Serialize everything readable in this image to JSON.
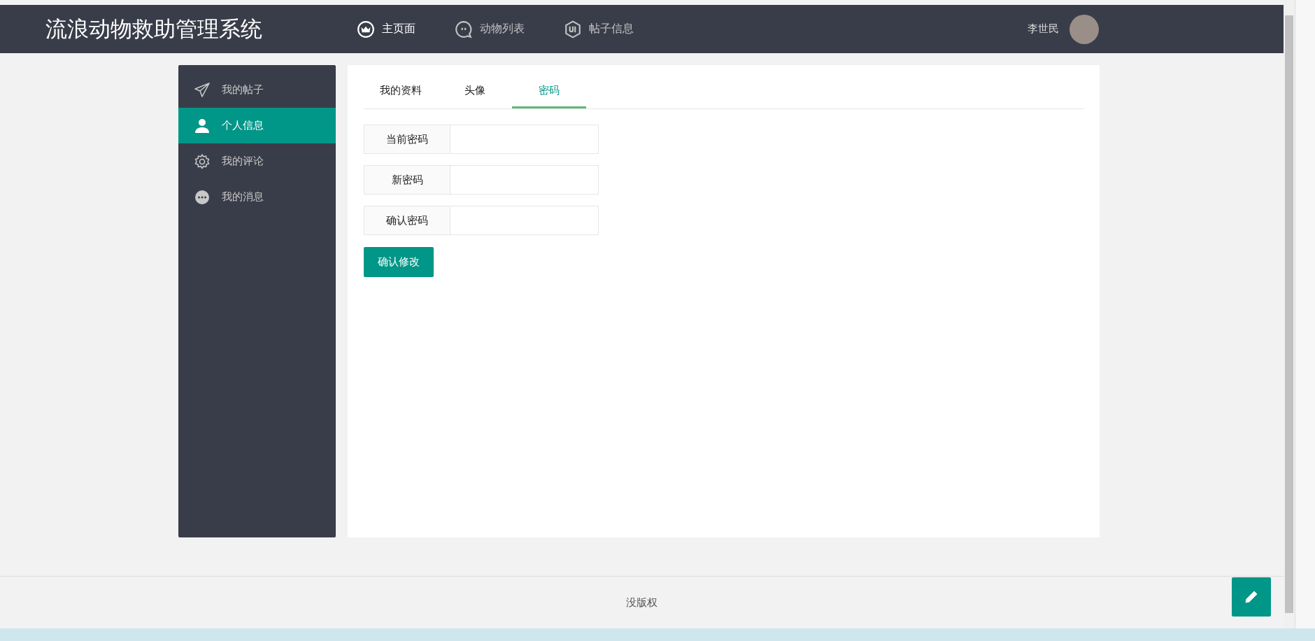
{
  "header": {
    "title": "流浪动物救助管理系统",
    "nav": [
      {
        "label": "主页面",
        "kind": "crown",
        "selected": true
      },
      {
        "label": "动物列表",
        "kind": "chat",
        "selected": false
      },
      {
        "label": "帖子信息",
        "kind": "hexagon",
        "selected": false
      }
    ],
    "user": {
      "name": "李世民"
    }
  },
  "sidebar": {
    "items": [
      {
        "label": "我的帖子",
        "kind": "plane",
        "selected": false
      },
      {
        "label": "个人信息",
        "kind": "person",
        "selected": true
      },
      {
        "label": "我的评论",
        "kind": "gear",
        "selected": false
      },
      {
        "label": "我的消息",
        "kind": "bubble",
        "selected": false
      }
    ]
  },
  "tabs": [
    {
      "label": "我的资料",
      "selected": false
    },
    {
      "label": "头像",
      "selected": false
    },
    {
      "label": "密码",
      "selected": true
    }
  ],
  "form": {
    "fields": [
      {
        "label": "当前密码"
      },
      {
        "label": "新密码"
      },
      {
        "label": "确认密码"
      }
    ],
    "submit": "确认修改"
  },
  "footer": {
    "text": "没版权"
  }
}
